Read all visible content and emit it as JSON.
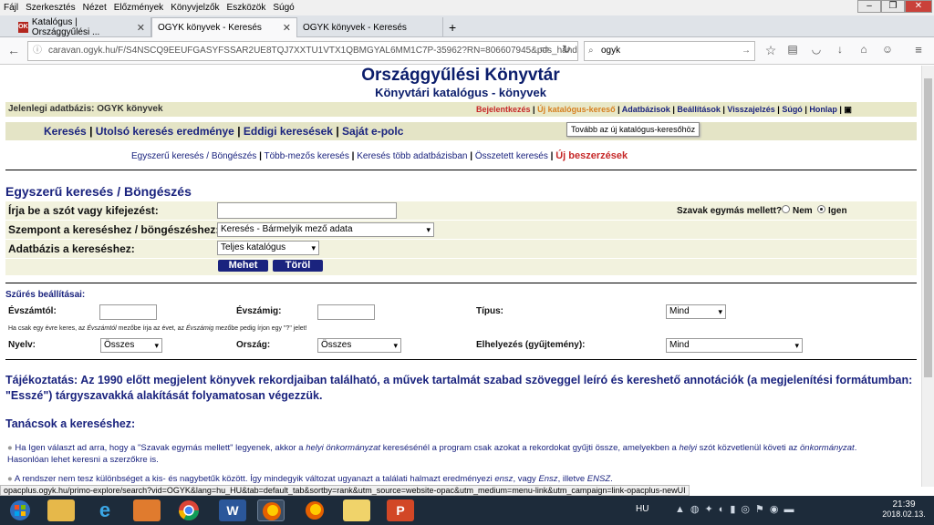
{
  "menu": [
    "Fájl",
    "Szerkesztés",
    "Nézet",
    "Előzmények",
    "Könyvjelzők",
    "Eszközök",
    "Súgó"
  ],
  "tabs": [
    {
      "label": "Katalógus | Országgyűlési ..."
    },
    {
      "label": "OGYK könyvek - Keresés"
    },
    {
      "label": "OGYK könyvek - Keresés"
    }
  ],
  "new_tab": "+",
  "url": "caravan.ogyk.hu/F/S4NSCQ9EEUFGASYFSSAR2UE8TQJ7XXTU1VTX1QBMGYAL6MM1C7P-35962?RN=806607945&pds_handle=GUEST",
  "search_value": "ogyk",
  "page": {
    "title": "Országgyűlési Könyvtár",
    "subtitle": "Könyvtári katalógus - könyvek",
    "current_db": "Jelenlegi adatbázis: OGYK könyvek",
    "toplinks": [
      "Bejelentkezés",
      "Új katalógus-kereső",
      "Adatbázisok",
      "Beállítások",
      "Visszajelzés",
      "Súgó",
      "Honlap"
    ],
    "tooltip": "Tovább az új katalógus-keresőhöz",
    "nav1": [
      "Keresés",
      "Utolsó keresés eredménye",
      "Eddigi keresések",
      "Saját e-polc"
    ],
    "nav2": [
      "Egyszerű keresés / Böngészés",
      "Több-mezős keresés",
      "Keresés több adatbázisban",
      "Összetett keresés",
      "Új beszerzések"
    ],
    "section_title": "Egyszerű keresés / Böngészés",
    "field1_label": "Írja be a szót vagy kifejezést:",
    "field2_label": "Szempont a kereséshez / böngészéshez:",
    "field2_value": "Keresés - Bármelyik mező adata",
    "field3_label": "Adatbázis a kereséshez:",
    "field3_value": "Teljes katalógus",
    "adjacent_label": "Szavak egymás mellett?",
    "adjacent_no": "Nem",
    "adjacent_yes": "Igen",
    "btn_go": "Mehet",
    "btn_clear": "Töröl",
    "filter_title": "Szűrés beállításai:",
    "from_year": "Évszámtól:",
    "to_year": "Évszámig:",
    "type_label": "Típus:",
    "type_value": "Mind",
    "year_hint_a": "Ha csak egy évre keres, az ",
    "year_hint_b": "Évszámtól",
    "year_hint_c": " mezőbe írja az évet, az ",
    "year_hint_d": "Évszámig",
    "year_hint_e": " mezőbe pedig írjon egy \"?\" jelet!",
    "lang_label": "Nyelv:",
    "lang_value": "Összes",
    "country_label": "Ország:",
    "country_value": "Összes",
    "location_label": "Elhelyezés (gyűjtemény):",
    "location_value": "Mind",
    "info": "Tájékoztatás: Az 1990 előtt megjelent könyvek rekordjaiban található, a művek tartalmát szabad szöveggel leíró és kereshető annotációk (a megjelenítési formátumban: \"Esszé\") tárgyszavakká alakítását folyamatosan végezzük.",
    "tips_title": "Tanácsok a kereséshez:",
    "tip1_a": "Ha Igen választ ad arra, hogy a \"Szavak egymás mellett\" legyenek, akkor a ",
    "tip1_b": "helyi önkormányzat",
    "tip1_c": " keresésénél a program csak azokat a rekordokat gyűjti össze, amelyekben a ",
    "tip1_d": "helyi",
    "tip1_e": " szót közvetlenül követi az ",
    "tip1_f": "önkormányzat",
    "tip1_g": ".",
    "tip1_line2": "Hasonlóan lehet keresni a szerzőkre is.",
    "tip2_a": "A rendszer nem tesz különbséget a kis- és nagybetűk között. Így mindegyik változat ugyanazt a találati halmazt eredményezi ",
    "tip2_b": "ensz",
    "tip2_c": ", vagy ",
    "tip2_d": "Ensz",
    "tip2_e": ", illetve ",
    "tip2_f": "ENSZ",
    "tip2_g": "."
  },
  "status_url": "opacplus.ogyk.hu/primo-explore/search?vid=OGYK&lang=hu_HU&tab=default_tab&sortby=rank&utm_source=website-opac&utm_medium=menu-link&utm_campaign=link-opacplus-newUI",
  "tray": {
    "lang": "HU",
    "time": "21:39",
    "date": "2018.02.13."
  }
}
